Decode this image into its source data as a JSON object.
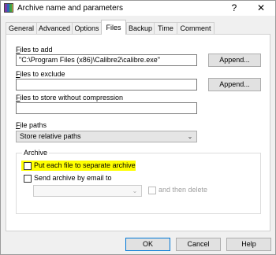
{
  "window": {
    "title": "Archive name and parameters",
    "help_glyph": "?",
    "close_glyph": "✕"
  },
  "tabs": [
    {
      "label": "General"
    },
    {
      "label": "Advanced"
    },
    {
      "label": "Options"
    },
    {
      "label": "Files"
    },
    {
      "label": "Backup"
    },
    {
      "label": "Time"
    },
    {
      "label": "Comment"
    }
  ],
  "files_to_add": {
    "label_prefix": "F",
    "label_rest": "iles to add",
    "value": "\"C:\\Program Files (x86)\\Calibre2\\calibre.exe\"",
    "button": "Append..."
  },
  "files_to_exclude": {
    "label_prefix": "F",
    "label_rest": "iles to exclude",
    "value": "",
    "button": "Append..."
  },
  "files_no_compression": {
    "label_prefix": "F",
    "label_rest": "iles to store without compression",
    "value": ""
  },
  "file_paths": {
    "label_prefix": "F",
    "label_rest": "ile paths",
    "selected": "Store relative paths",
    "caret": "⌄"
  },
  "archive_group": {
    "title": "Archive",
    "separate_archive": {
      "label": "Put each file to separate archive",
      "checked": false
    },
    "send_email": {
      "label": "Send archive by email to",
      "checked": false
    },
    "email_select": {
      "selected": "",
      "caret": "⌄"
    },
    "then_delete": {
      "label": "and then delete",
      "checked": false
    }
  },
  "footer": {
    "ok": "OK",
    "cancel": "Cancel",
    "help": "Help"
  },
  "colors": {
    "highlight": "#ffff00",
    "default_button_border": "#0078d7"
  }
}
